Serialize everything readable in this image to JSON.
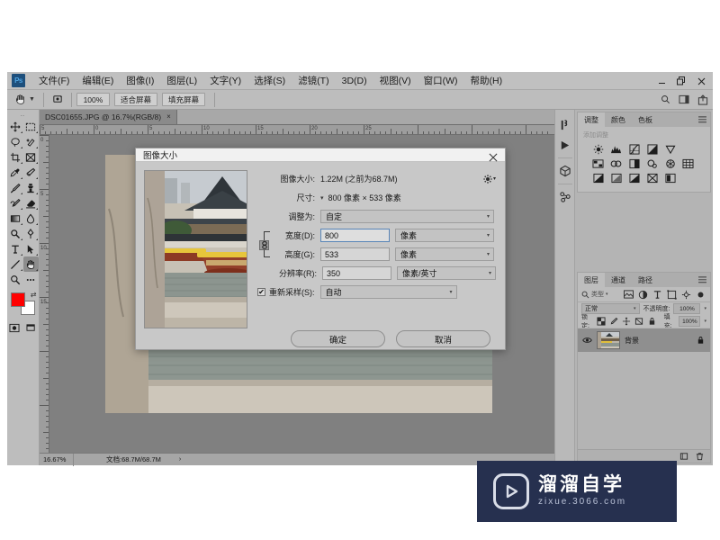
{
  "app": {
    "logo_text": "Ps",
    "window_controls": [
      "minimize",
      "restore",
      "close"
    ]
  },
  "menubar": {
    "items": [
      {
        "label": "文件(F)"
      },
      {
        "label": "编辑(E)"
      },
      {
        "label": "图像(I)"
      },
      {
        "label": "图层(L)"
      },
      {
        "label": "文字(Y)"
      },
      {
        "label": "选择(S)"
      },
      {
        "label": "滤镜(T)"
      },
      {
        "label": "3D(D)"
      },
      {
        "label": "视图(V)"
      },
      {
        "label": "窗口(W)"
      },
      {
        "label": "帮助(H)"
      }
    ]
  },
  "options_bar": {
    "active_tool": "hand-tool",
    "buttons": [
      {
        "label": "100%"
      },
      {
        "label": "适合屏幕"
      },
      {
        "label": "填充屏幕"
      }
    ],
    "right_icons": [
      "search-icon",
      "workspace-icon",
      "share-icon"
    ]
  },
  "toolbar": {
    "tools": [
      {
        "name": "move-tool"
      },
      {
        "name": "rectangular-marquee-tool"
      },
      {
        "name": "lasso-tool"
      },
      {
        "name": "quick-selection-tool"
      },
      {
        "name": "crop-tool"
      },
      {
        "name": "frame-tool"
      },
      {
        "name": "eyedropper-tool"
      },
      {
        "name": "spot-healing-tool"
      },
      {
        "name": "brush-tool"
      },
      {
        "name": "clone-stamp-tool"
      },
      {
        "name": "history-brush-tool"
      },
      {
        "name": "eraser-tool"
      },
      {
        "name": "gradient-tool"
      },
      {
        "name": "blur-tool"
      },
      {
        "name": "dodge-tool"
      },
      {
        "name": "pen-tool"
      },
      {
        "name": "horizontal-type-tool"
      },
      {
        "name": "path-selection-tool"
      },
      {
        "name": "rectangle-tool"
      },
      {
        "name": "hand-tool"
      },
      {
        "name": "zoom-tool"
      },
      {
        "name": "edit-toolbar-tool"
      }
    ],
    "selected_tool": "hand-tool",
    "foreground_color": "#ff0000",
    "background_color": "#ffffff"
  },
  "document": {
    "tab_title": "DSC01655.JPG @ 16.7%(RGB/8)",
    "tab_close": "×",
    "ruler_labels_h": [
      "5",
      "0",
      "5",
      "10",
      "15",
      "20",
      "25"
    ],
    "ruler_labels_v": [
      "0",
      "5",
      "10",
      "15"
    ]
  },
  "status_bar": {
    "zoom": "16.67%",
    "doc_info": "文档:68.7M/68.7M",
    "expand_arrow": "›"
  },
  "right_dock": {
    "icons": [
      "history-icon",
      "actions-play-icon",
      "3d-cube-icon",
      "cc-libraries-icon"
    ]
  },
  "adjustments_panel": {
    "tabs": [
      {
        "label": "调整",
        "active": true
      },
      {
        "label": "颜色",
        "active": false
      },
      {
        "label": "色板",
        "active": false
      }
    ],
    "section_title": "添加调整",
    "menu_icon": "panel-menu-icon",
    "icons": [
      "brightness-contrast-icon",
      "levels-icon",
      "curves-icon",
      "exposure-icon",
      "vibrance-icon",
      "hue-saturation-icon",
      "color-balance-icon",
      "black-white-icon",
      "photo-filter-icon",
      "channel-mixer-icon",
      "color-lookup-icon",
      "invert-icon",
      "posterize-icon",
      "threshold-icon",
      "gradient-map-icon",
      "selective-color-icon"
    ]
  },
  "layers_panel": {
    "tabs": [
      {
        "label": "图层",
        "active": true
      },
      {
        "label": "通道",
        "active": false
      },
      {
        "label": "路径",
        "active": false
      }
    ],
    "menu_icon": "panel-menu-icon",
    "filter": {
      "search_placeholder": "类型",
      "search_icon": "search-icon",
      "filter_icons": [
        "pixel-filter-icon",
        "adjustment-filter-icon",
        "type-filter-icon",
        "shape-filter-icon",
        "smart-object-filter-icon"
      ],
      "toggle_icon": "filter-toggle-icon"
    },
    "blend_mode": "正常",
    "opacity_label": "不透明度:",
    "opacity_value": "100%",
    "lock_label": "锁定:",
    "lock_icons": [
      "lock-transparent-icon",
      "lock-image-icon",
      "lock-position-icon",
      "lock-artboard-icon",
      "lock-all-icon"
    ],
    "fill_label": "填充:",
    "fill_value": "100%",
    "layers": [
      {
        "name": "背景",
        "visible": true,
        "locked": true,
        "lock_icon": "lock-icon",
        "eye_icon": "eye-icon"
      }
    ],
    "footer_icons": [
      "new-layer-icon",
      "delete-layer-icon"
    ]
  },
  "dialog": {
    "title": "图像大小",
    "close_icon": "close-icon",
    "gear_icon": "gear-icon",
    "image_size_label": "图像大小:",
    "image_size_value": "1.22M (之前为68.7M)",
    "dimensions_label": "尺寸:",
    "dimensions_value": "800 像素  ×  533 像素",
    "dimensions_caret": "chevron-down-icon",
    "fit_to_label": "调整为:",
    "fit_to_value": "自定",
    "width_label": "宽度(D):",
    "width_value": "800",
    "width_unit": "像素",
    "height_label": "高度(G):",
    "height_value": "533",
    "height_unit": "像素",
    "resolution_label": "分辨率(R):",
    "resolution_value": "350",
    "resolution_unit": "像素/英寸",
    "constrain_icon": "link-chain-icon",
    "resample_label": "重新采样(S):",
    "resample_checked": true,
    "resample_checkmark": "✔",
    "resample_value": "自动",
    "ok_label": "确定",
    "cancel_label": "取消"
  },
  "watermark": {
    "logo_icon": "play-button-logo",
    "title": "溜溜自学",
    "url": "zixue.3066.com",
    "background_color": "#26304f"
  }
}
